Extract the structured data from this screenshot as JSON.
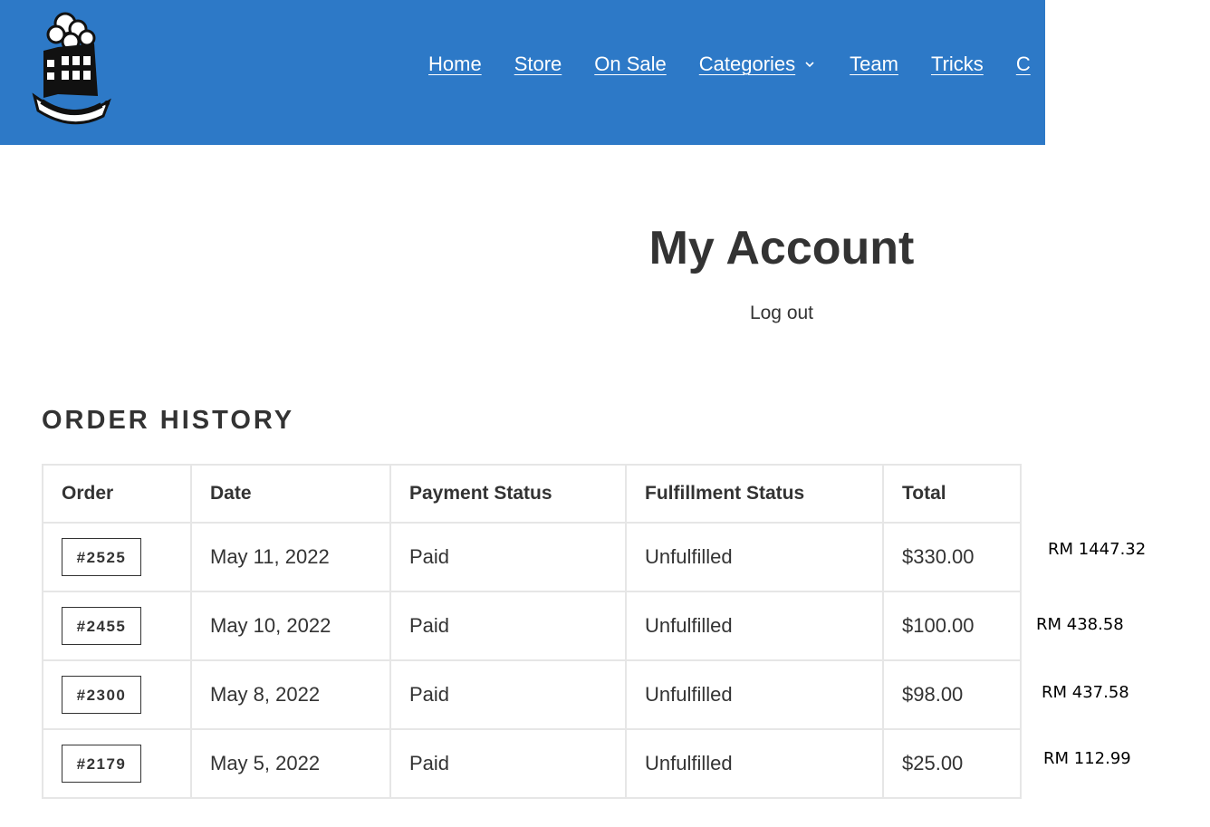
{
  "header": {
    "logo_icon": "yoyo-factory-logo-icon",
    "nav": [
      {
        "label": "Home"
      },
      {
        "label": "Store"
      },
      {
        "label": "On Sale"
      },
      {
        "label": "Categories",
        "has_dropdown": true
      },
      {
        "label": "Team"
      },
      {
        "label": "Tricks"
      },
      {
        "label": "C"
      }
    ]
  },
  "main": {
    "title": "My Account",
    "logout_label": "Log out",
    "section_title": "ORDER HISTORY"
  },
  "table": {
    "headers": [
      "Order",
      "Date",
      "Payment Status",
      "Fulfillment Status",
      "Total"
    ],
    "rows": [
      {
        "order": "#2525",
        "date": "May 11, 2022",
        "payment": "Paid",
        "fulfillment": "Unfulfilled",
        "total": "$330.00"
      },
      {
        "order": "#2455",
        "date": "May 10, 2022",
        "payment": "Paid",
        "fulfillment": "Unfulfilled",
        "total": "$100.00"
      },
      {
        "order": "#2300",
        "date": "May 8, 2022",
        "payment": "Paid",
        "fulfillment": "Unfulfilled",
        "total": "$98.00"
      },
      {
        "order": "#2179",
        "date": "May 5, 2022",
        "payment": "Paid",
        "fulfillment": "Unfulfilled",
        "total": "$25.00"
      }
    ]
  },
  "annotations": [
    "RM 1447.32",
    "RM 438.58",
    "RM 437.58",
    "RM 112.99"
  ],
  "colors": {
    "header_bg": "#2d79c7",
    "text": "#333333",
    "border": "#e6e6e6"
  }
}
